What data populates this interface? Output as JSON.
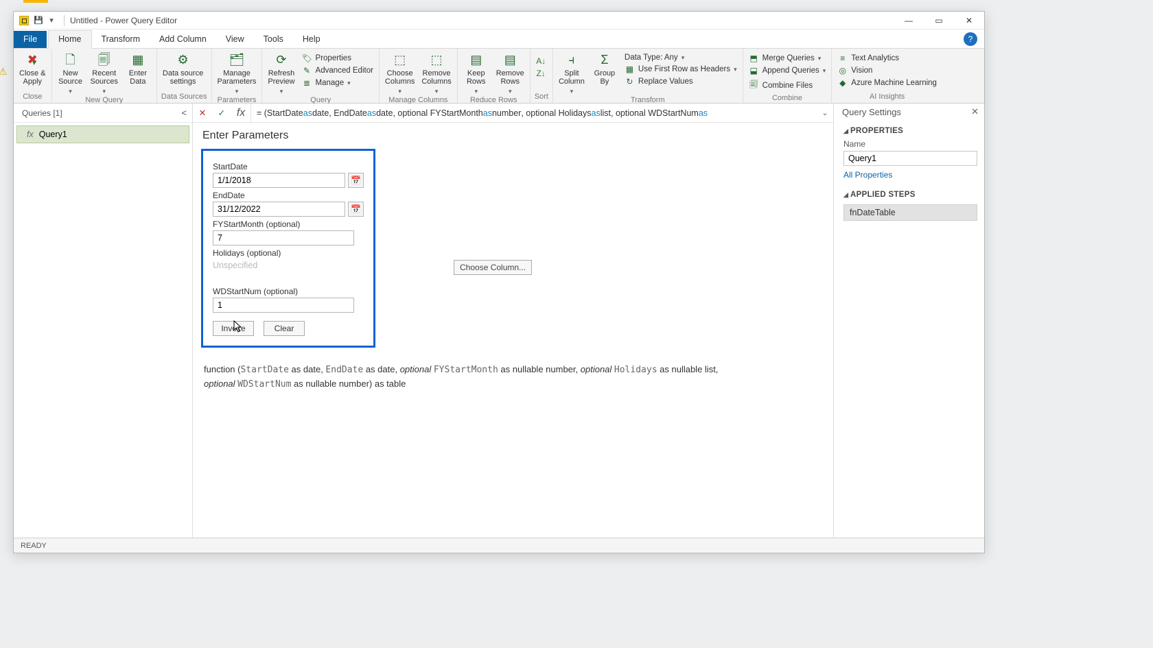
{
  "title": "Untitled - Power Query Editor",
  "tabs": {
    "file": "File",
    "home": "Home",
    "transform": "Transform",
    "addcol": "Add Column",
    "view": "View",
    "tools": "Tools",
    "help": "Help"
  },
  "ribbon": {
    "close": {
      "label": "Close &\nApply",
      "group": "Close"
    },
    "newq": {
      "new": "New\nSource",
      "recent": "Recent\nSources",
      "enter": "Enter\nData",
      "group": "New Query"
    },
    "ds": {
      "label": "Data source\nsettings",
      "group": "Data Sources"
    },
    "param": {
      "label": "Manage\nParameters",
      "group": "Parameters"
    },
    "query": {
      "refresh": "Refresh\nPreview",
      "props": "Properties",
      "adv": "Advanced Editor",
      "manage": "Manage",
      "group": "Query"
    },
    "mc": {
      "choose": "Choose\nColumns",
      "remove": "Remove\nColumns",
      "group": "Manage Columns"
    },
    "rr": {
      "keep": "Keep\nRows",
      "remove": "Remove\nRows",
      "group": "Reduce Rows"
    },
    "sort": {
      "group": "Sort"
    },
    "trans": {
      "split": "Split\nColumn",
      "group": "Group\nBy",
      "dtype": "Data Type: Any",
      "firstrow": "Use First Row as Headers",
      "replace": "Replace Values",
      "glabel": "Transform"
    },
    "comb": {
      "merge": "Merge Queries",
      "append": "Append Queries",
      "files": "Combine Files",
      "group": "Combine"
    },
    "ai": {
      "text": "Text Analytics",
      "vision": "Vision",
      "aml": "Azure Machine Learning",
      "group": "AI Insights"
    }
  },
  "queriesPane": {
    "hdr": "Queries [1]",
    "q1": "Query1"
  },
  "formula": {
    "prefix": "= (StartDate ",
    "k1": "as",
    "t1": " date",
    "c1": ", EndDate ",
    "k2": "as",
    "t2": " date",
    "c2": ", optional FYStartMonth ",
    "k3": "as",
    "t3": " number",
    "c3": ", optional Holidays ",
    "k4": "as",
    "t4": " list",
    "c4": ", optional WDStartNum ",
    "k5": "as"
  },
  "params": {
    "hdr": "Enter Parameters",
    "p1": {
      "label": "StartDate",
      "val": "1/1/2018"
    },
    "p2": {
      "label": "EndDate",
      "val": "31/12/2022"
    },
    "p3": {
      "label": "FYStartMonth (optional)",
      "val": "7"
    },
    "p4": {
      "label": "Holidays (optional)",
      "ph": "Unspecified",
      "choose": "Choose Column..."
    },
    "p5": {
      "label": "WDStartNum (optional)",
      "val": "1"
    },
    "invoke": "Invoke",
    "clear": "Clear"
  },
  "sig": {
    "pre": "function (",
    "sd": "StartDate",
    "t1": " as date, ",
    "ed": "EndDate",
    "t2": " as date, ",
    "opt1": "optional ",
    "fy": "FYStartMonth",
    "t3": " as nullable number, ",
    "opt2": "optional ",
    "hol": "Holidays",
    "t4": " as nullable list, ",
    "opt3": "optional ",
    "wd": "WDStartNum",
    "t5": " as nullable number) as table"
  },
  "settings": {
    "hdr": "Query Settings",
    "props": "PROPERTIES",
    "nameLbl": "Name",
    "nameVal": "Query1",
    "allprops": "All Properties",
    "steps": "APPLIED STEPS",
    "step1": "fnDateTable"
  },
  "status": "READY"
}
